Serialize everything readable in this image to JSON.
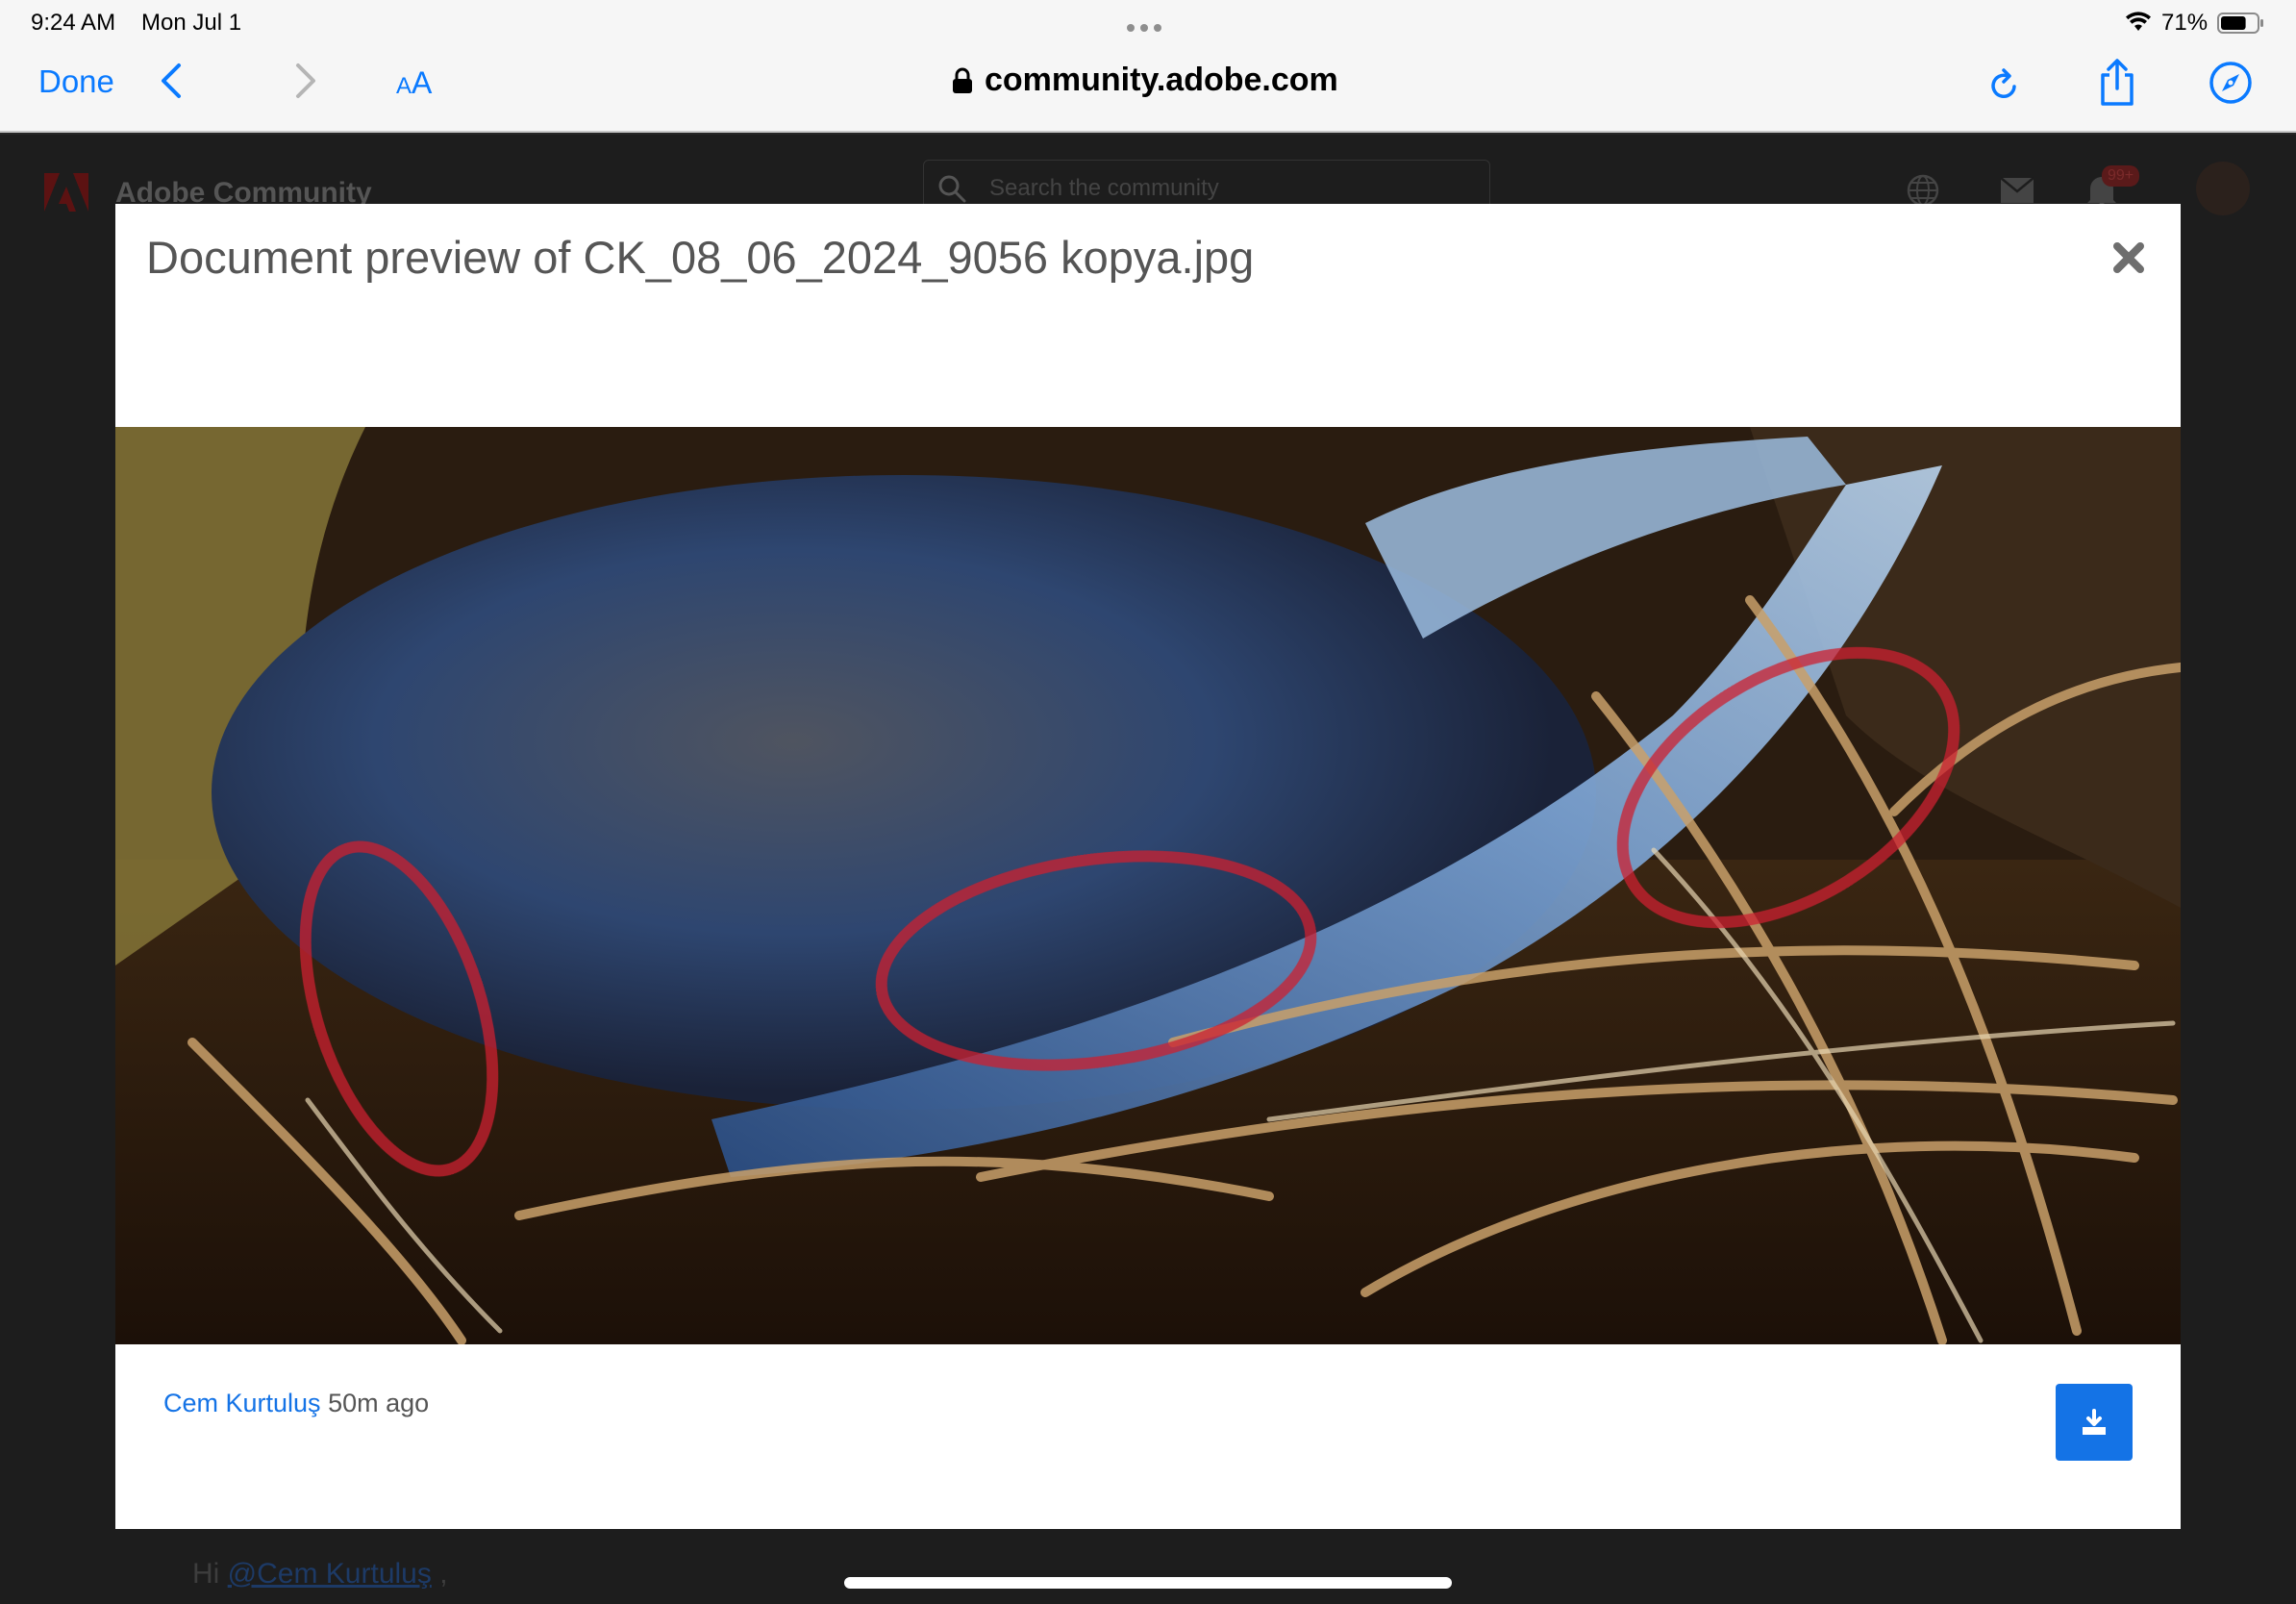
{
  "status_bar": {
    "time": "9:24 AM",
    "date": "Mon Jul 1",
    "battery_percent": "71%",
    "battery_level": 0.71,
    "icons": [
      "wifi-icon",
      "battery-icon"
    ]
  },
  "browser_toolbar": {
    "done_label": "Done",
    "text_size_small": "A",
    "text_size_big": "A",
    "address": "community.adobe.com",
    "icons": [
      "chevron-left-icon",
      "chevron-right-icon",
      "lock-icon",
      "reload-icon",
      "share-icon",
      "compass-icon"
    ],
    "accent_color": "#0a7aff"
  },
  "background_page": {
    "site_title": "Adobe Community",
    "search_placeholder": "Search the community",
    "notification_badge": "99+",
    "reply_prefix": "Hi ",
    "reply_mention": "@Cem Kurtuluş",
    "reply_suffix": " ,",
    "icons": [
      "adobe-logo-icon",
      "search-icon",
      "globe-icon",
      "mail-icon",
      "bell-icon",
      "avatar"
    ]
  },
  "modal": {
    "title": "Document preview of CK_08_06_2024_9056 kopya.jpg",
    "author": "Cem Kurtuluş",
    "timestamp": "50m ago",
    "icons": [
      "close-icon",
      "download-icon"
    ],
    "download_color": "#1473e6"
  }
}
